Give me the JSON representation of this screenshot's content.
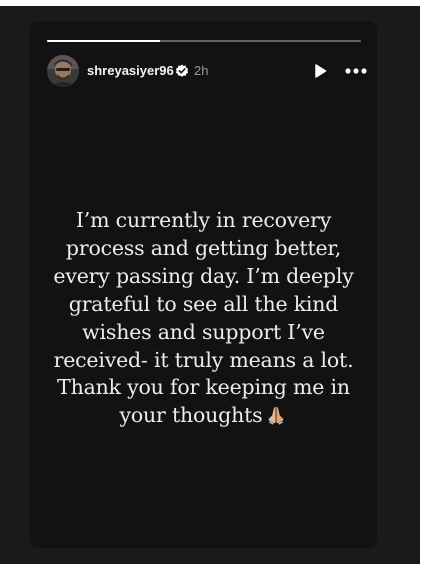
{
  "story": {
    "progress": 0.36,
    "user": {
      "username": "shreyasiyer96",
      "verified": true,
      "time_ago": "2h",
      "avatar_icon": "profile-photo"
    },
    "controls": {
      "play_icon": "play-icon",
      "more_icon": "more-options-icon"
    },
    "message": "I’m currently in recovery process and getting better, every passing day. I’m deeply grateful to see all the kind wishes and support I’ve received- it truly means a lot. Thank you for keeping me in your thoughts",
    "emoji_icon": "folded-hands-icon"
  },
  "colors": {
    "page_background": "#1a1a1a",
    "story_background": "#121212",
    "text": "#ececec",
    "verified_badge": "#ffffff",
    "time": "#9a9a9a"
  }
}
